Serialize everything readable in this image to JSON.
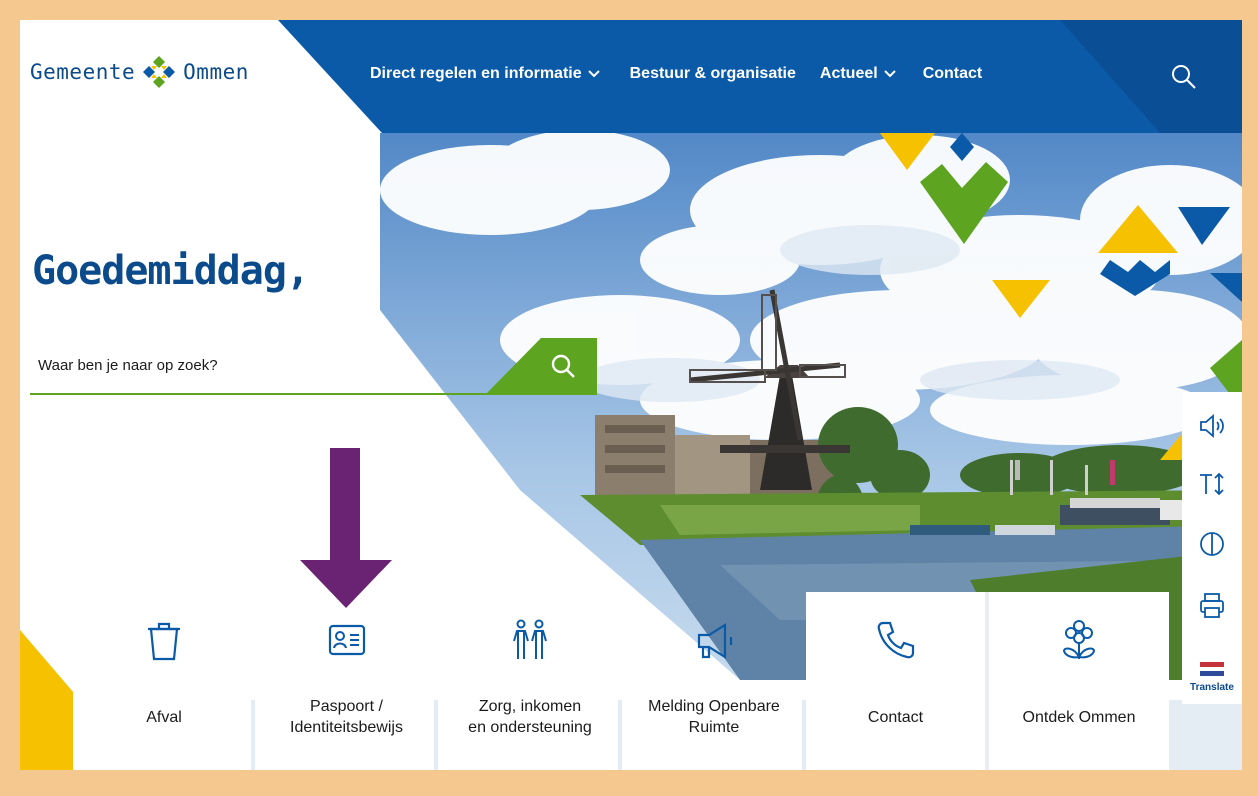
{
  "brand": {
    "name_left": "Gemeente",
    "name_right": "Ommen",
    "primary_color": "#0b5aa8",
    "accent_green": "#5da421",
    "accent_yellow": "#f6c100"
  },
  "nav": {
    "items": [
      {
        "label": "Direct regelen en informatie",
        "has_dropdown": true
      },
      {
        "label": "Bestuur & organisatie",
        "has_dropdown": false
      },
      {
        "label": "Actueel",
        "has_dropdown": true
      },
      {
        "label": "Contact",
        "has_dropdown": false
      }
    ],
    "search_icon": "search-icon"
  },
  "hero": {
    "greeting": "Goedemiddag,"
  },
  "search": {
    "placeholder": "Waar ben je naar op zoek?",
    "value": "",
    "button_icon": "search-icon"
  },
  "tiles": [
    {
      "label": "Afval",
      "icon": "trash-icon"
    },
    {
      "label": "Paspoort /\nIdentiteitsbewijs",
      "icon": "id-card-icon"
    },
    {
      "label": "Zorg, inkomen\nen ondersteuning",
      "icon": "people-icon"
    },
    {
      "label": "Melding Openbare\nRuimte",
      "icon": "megaphone-icon"
    },
    {
      "label": "Contact",
      "icon": "phone-icon"
    },
    {
      "label": "Ontdek Ommen",
      "icon": "flower-icon"
    }
  ],
  "side_toolbar": {
    "items": [
      "speaker-icon",
      "text-size-icon",
      "contrast-icon",
      "print-icon"
    ],
    "translate_label": "Translate"
  }
}
